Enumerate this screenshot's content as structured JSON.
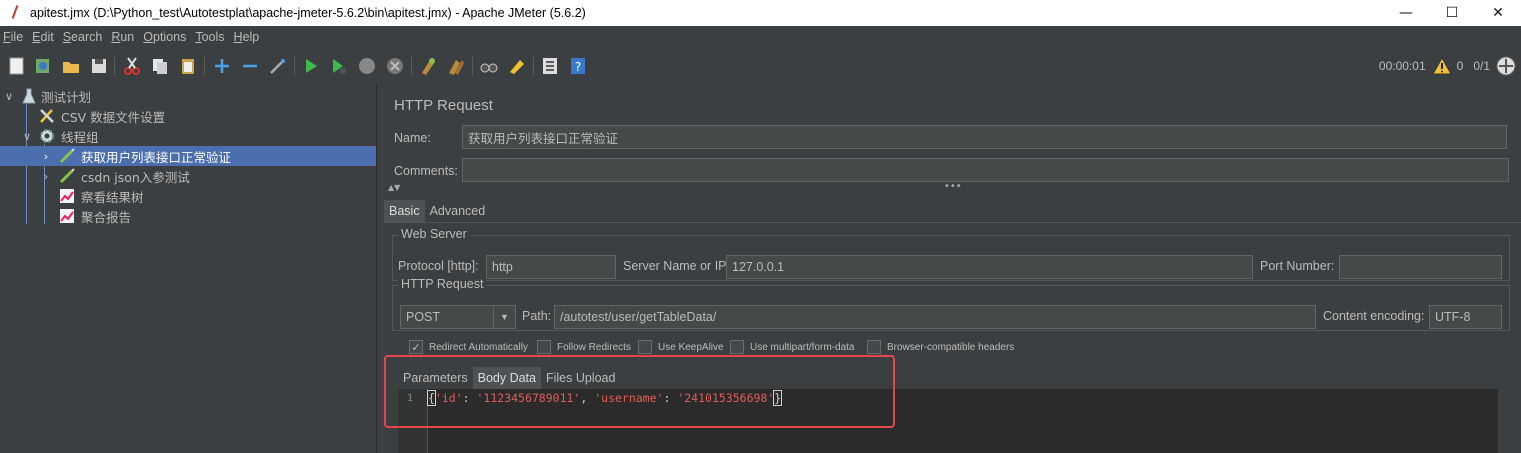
{
  "window": {
    "title": "apitest.jmx (D:\\Python_test\\Autotestplat\\apache-jmeter-5.6.2\\bin\\apitest.jmx) - Apache JMeter (5.6.2)",
    "minimize": "—",
    "maximize": "☐",
    "close": "✕"
  },
  "menu": [
    "File",
    "Edit",
    "Search",
    "Run",
    "Options",
    "Tools",
    "Help"
  ],
  "toolbar": {
    "icons": [
      "new-icon",
      "templates-icon",
      "open-icon",
      "save-icon",
      "cut-icon",
      "copy-icon",
      "paste-icon",
      "expand-icon",
      "collapse-icon",
      "toggle-icon",
      "start-icon",
      "start-no-pauses-icon",
      "stop-icon",
      "shutdown-icon",
      "clear-icon",
      "clear-all-icon",
      "search-icon",
      "reset-search-icon",
      "function-helper-icon",
      "help-icon"
    ],
    "timer": "00:00:01",
    "warnings": "0",
    "threads": "0/1"
  },
  "tree": {
    "items": [
      {
        "label": "测试计划",
        "icon": "test-plan-icon"
      },
      {
        "label": "CSV 数据文件设置",
        "icon": "config-tools-icon"
      },
      {
        "label": "线程组",
        "icon": "gear-icon"
      },
      {
        "label": "获取用户列表接口正常验证",
        "icon": "sampler-pen-icon"
      },
      {
        "label": "csdn json入参测试",
        "icon": "sampler-pen-icon"
      },
      {
        "label": "察看结果树",
        "icon": "listener-chart-icon"
      },
      {
        "label": "聚合报告",
        "icon": "listener-chart-icon"
      }
    ]
  },
  "panel": {
    "title": "HTTP Request",
    "name_label": "Name:",
    "name_value": "获取用户列表接口正常验证",
    "comments_label": "Comments:",
    "comments_value": "",
    "tabs": [
      "Basic",
      "Advanced"
    ],
    "web_server": {
      "title": "Web Server",
      "protocol_label": "Protocol [http]:",
      "protocol_value": "http",
      "server_label": "Server Name or IP:",
      "server_value": "127.0.0.1",
      "port_label": "Port Number:",
      "port_value": ""
    },
    "http_request": {
      "title": "HTTP Request",
      "method": "POST",
      "path_label": "Path:",
      "path_value": "/autotest/user/getTableData/",
      "encoding_label": "Content encoding:",
      "encoding_value": "UTF-8"
    },
    "checkboxes": [
      {
        "label": "Redirect Automatically",
        "checked": true
      },
      {
        "label": "Follow Redirects",
        "checked": false
      },
      {
        "label": "Use KeepAlive",
        "checked": false
      },
      {
        "label": "Use multipart/form-data",
        "checked": false
      },
      {
        "label": "Browser-compatible headers",
        "checked": false
      }
    ],
    "subtabs": [
      "Parameters",
      "Body Data",
      "Files Upload"
    ],
    "body": {
      "line_number": "1",
      "open": "{",
      "key1": "'id'",
      "colon1": ": ",
      "val1": "'1123456789011'",
      "comma": ", ",
      "key2": "'username'",
      "colon2": ": ",
      "val2": "'241015356698'",
      "close": "}"
    }
  },
  "colors": {
    "background": "#3c3f41",
    "selection": "#4b6eaf",
    "highlight_box": "#e54848",
    "string": "#e25c5c"
  }
}
